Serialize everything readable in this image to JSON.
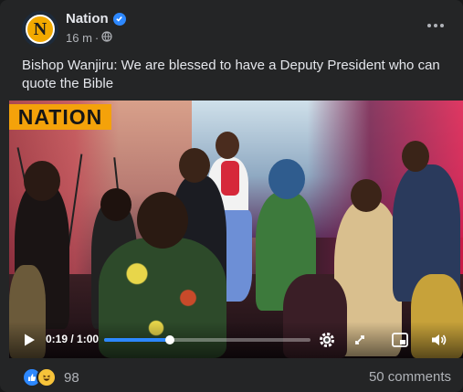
{
  "post": {
    "author": "Nation",
    "avatar_letter": "N",
    "time": "16 m",
    "audience_separator": "·",
    "text": "Bishop Wanjiru: We are blessed to have a Deputy President who can quote the Bible"
  },
  "video": {
    "watermark": "NATION",
    "current_time": "0:19",
    "duration": "1:00",
    "time_display": "0:19 / 1:00",
    "progress_fraction": 0.32,
    "controls": [
      "play-icon",
      "settings-icon",
      "fullscreen-icon",
      "picture-in-picture-icon",
      "volume-icon"
    ]
  },
  "footer": {
    "reaction_icons": [
      "like-icon",
      "haha-icon"
    ],
    "reaction_count": "98",
    "comments_label": "50 comments"
  },
  "colors": {
    "background": "#242526",
    "accent": "#2d88ff",
    "logo": "#f4a20a",
    "text_primary": "#e4e6eb",
    "text_secondary": "#b0b3b8"
  }
}
